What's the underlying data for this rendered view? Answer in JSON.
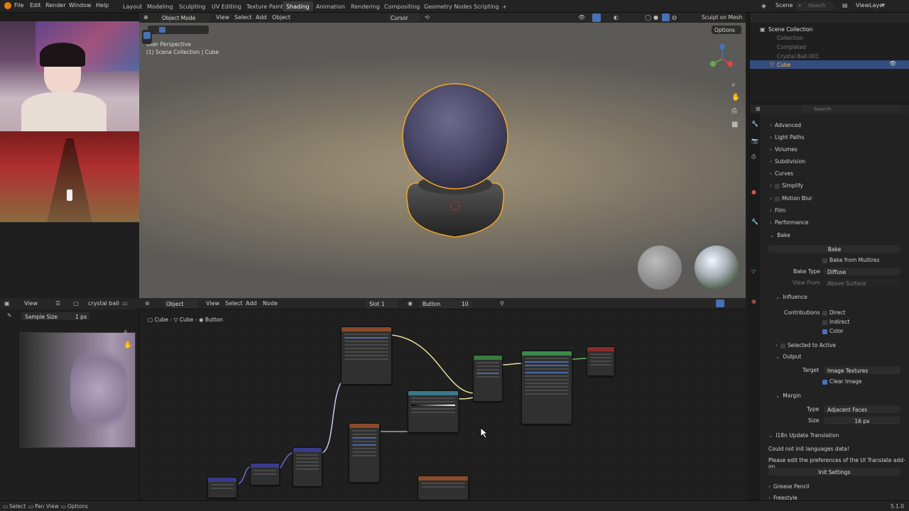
{
  "topbar": {
    "menus": [
      "File",
      "Edit",
      "Render",
      "Window",
      "Help"
    ],
    "workspaces": [
      "Layout",
      "Modeling",
      "Sculpting",
      "UV Editing",
      "Texture Paint",
      "Shading",
      "Animation",
      "Rendering",
      "Compositing",
      "Geometry Nodes",
      "Scripting"
    ],
    "active_workspace": "Shading",
    "add_tab": "+",
    "scene": "Scene",
    "view_layer": "ViewLayer",
    "search_placeholder": "Search"
  },
  "viewport": {
    "mode": "Object Mode",
    "menus": [
      "View",
      "Select",
      "Add",
      "Object"
    ],
    "transform": "Cursor",
    "sculpt_on_mesh": "Sculpt on Mesh",
    "options": "Options",
    "perspective_label": "User Perspective",
    "collection_label": "(1) Scene Collection | Cube"
  },
  "image_editor": {
    "view": "View",
    "image_name": "crystal ball",
    "sample_label": "Sample Size",
    "sample_value": "1 px"
  },
  "node_editor": {
    "object_menu": "Object",
    "menus": [
      "View",
      "Select",
      "Add",
      "Node"
    ],
    "slot": "Slot 1",
    "material": "Button",
    "users": "10",
    "breadcrumb": [
      "Cube",
      "Cube",
      "Button"
    ]
  },
  "outliner": {
    "title": "Scene Collection",
    "items": [
      "Collection",
      "Completed",
      "Crystal Ball.001",
      "Cube"
    ]
  },
  "properties": {
    "search_placeholder": "Search",
    "sections": [
      "Advanced",
      "Light Paths",
      "Volumes",
      "Subdivision",
      "Curves",
      "Simplify",
      "Motion Blur",
      "Film",
      "Performance",
      "Bake"
    ],
    "bake_button": "Bake",
    "bake_from_multires": "Bake from Multires",
    "bake_type_label": "Bake Type",
    "bake_type_value": "Diffuse",
    "view_from_label": "View From",
    "view_from_value": "Above Surface",
    "influence": "Influence",
    "contributions_label": "Contributions",
    "direct": "Direct",
    "indirect": "Indirect",
    "color": "Color",
    "selected_to_active": "Selected to Active",
    "output": "Output",
    "target_label": "Target",
    "target_value": "Image Textures",
    "clear_image": "Clear Image",
    "margin": "Margin",
    "type_label": "Type",
    "type_value": "Adjacent Faces",
    "size_label": "Size",
    "size_value": "16 px",
    "i18n_title": "I18n Update Translation",
    "i18n_msg1": "Could not init languages data!",
    "i18n_msg2": "Please edit the preferences of the UI Translate add-on",
    "init_settings": "Init Settings",
    "grease_pencil": "Grease Pencil",
    "freestyle": "Freestyle"
  },
  "statusbar": {
    "select": "Select",
    "pan_view": "Pan View",
    "options": "Options",
    "version": "5.1.0"
  },
  "colors": {
    "accent": "#4772b3",
    "selection_outline": "#f5a623",
    "active_tab": "#3a3a3a"
  }
}
